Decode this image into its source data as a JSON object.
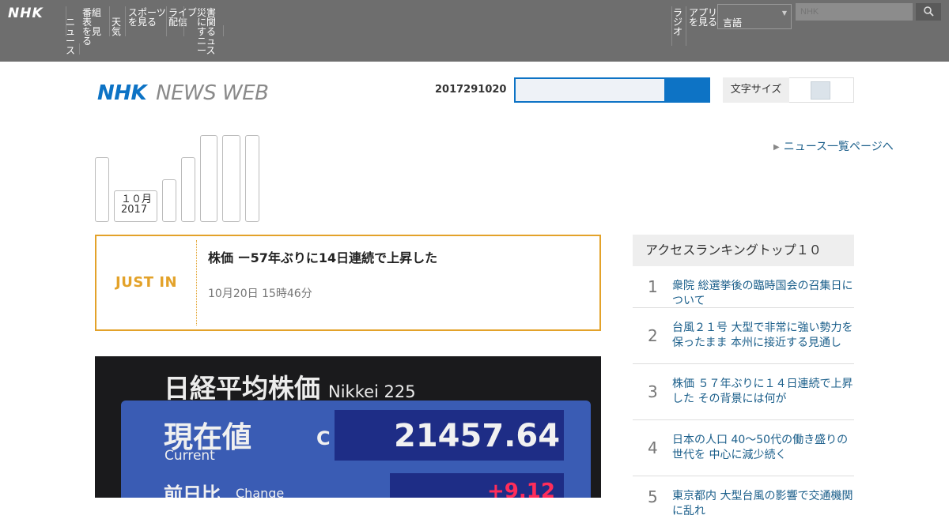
{
  "topbar": {
    "logo": "NHK",
    "nav": [
      {
        "label": "ニュ\nース"
      },
      {
        "label": "番組表\nを見る"
      },
      {
        "label": "天気"
      },
      {
        "label": "スポーツ\nを見る"
      },
      {
        "label": "ライブ\n配信"
      },
      {
        "label": "災害\nに関する\nニュース"
      }
    ],
    "right_nav": [
      {
        "label": "ラジ\nオ"
      },
      {
        "label": "アプリ\nを見る"
      }
    ],
    "lang_select": "言語",
    "search_placeholder": "NHK",
    "search_icon": "search-icon"
  },
  "header": {
    "brand_primary": "NHK",
    "brand_secondary": "NEWS WEB",
    "date": "2017291020",
    "search_value": "",
    "toggle_label": "文字サイズ"
  },
  "calendar": {
    "label_line1": "１０月",
    "label_line2": "2017"
  },
  "side_link": "ニュース一覧ページへ",
  "just_in": {
    "label": "JUST IN",
    "title": "株価 ー57年ぶりに14日連続で上昇した",
    "date": "10月20日 15時46分"
  },
  "photo": {
    "title": "日経平均株価",
    "title_en": "Nikkei 225",
    "current_label": "現在値",
    "current_en": "Current",
    "c_marker": "C",
    "value": "21457.64",
    "change_label": "前日比",
    "change_en": "Change",
    "change_value": "+9.12"
  },
  "ranking": {
    "heading": "アクセスランキングトップ１０",
    "items": [
      {
        "num": "1",
        "text": "衆院 総選挙後の臨時国会の召集日について"
      },
      {
        "num": "2",
        "text": "台風２１号 大型で非常に強い勢力を保ったまま 本州に接近する見通し"
      },
      {
        "num": "3",
        "text": "株価 ５７年ぶりに１４日連続で上昇した その背景には何が"
      },
      {
        "num": "4",
        "text": "日本の人口 40～50代の働き盛りの世代を 中心に減少続く"
      },
      {
        "num": "5",
        "text": "東京都内 大型台風の影響で交通機関に乱れ"
      }
    ]
  }
}
